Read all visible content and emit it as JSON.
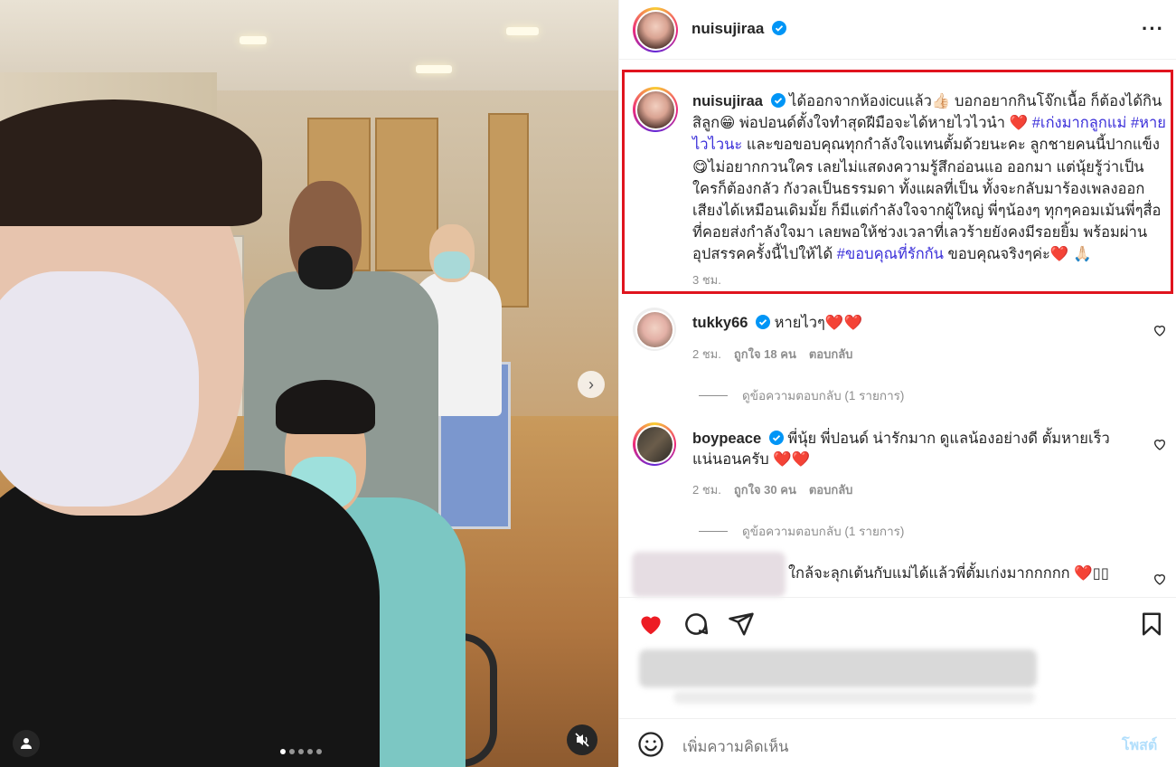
{
  "post": {
    "username": "nuisujiraa",
    "caption_parts": {
      "p1": "ได้ออกจากห้องicuแล้ว👍🏻 บอกอยากกินโจ๊กเนื้อ ก็ต้องได้กินสิลูก😁 พ่อปอนด์ตั้งใจทำสุดฝีมือจะได้หายไวไวน๋า ",
      "heart1": "❤️",
      "tag1": "#เก่งมากลูกแม่",
      "tag2": "#หายไวไวนะ",
      "p2": " และขอขอบคุณทุกกำลังใจแทนตั้มด้วยนะคะ ลูกชายคนนี้ปากแข็ง😋ไม่อยากกวนใคร เลยไม่แสดงความรู้สึกอ่อนแอ ออกมา แต่นุ้ยรู้ว่าเป็นใครก็ต้องกลัว กังวลเป็นธรรมดา ทั้งแผลที่เป็น ทั้งจะกลับมาร้องเพลงออกเสียงได้เหมือนเดิมมั้ย ก็มีแต่กำลังใจจากผู้ใหญ่ พี่ๆน้องๆ ทุกๆคอมเม้นพี่ๆสื่อที่คอยส่งกำลังใจมา เลยพอให้ช่วงเวลาที่เลวร้ายยังคงมีรอยยิ้ม พร้อมผ่านอุปสรรคครั้งนี้ไปให้ได้ ",
      "tag3": "#ขอบคุณที่รักกัน",
      "p3": " ขอบคุณจริงๆค่ะ",
      "heart2": "❤️",
      "pray": " 🙏🏻"
    },
    "time": "3 ชม."
  },
  "comments": [
    {
      "username": "tukky66",
      "text": " หายไวๆ",
      "hearts": "❤️❤️",
      "time": "2 ชม.",
      "likes": "ถูกใจ 18 คน",
      "reply": "ตอบกลับ",
      "view_replies": "ดูข้อความตอบกลับ (1 รายการ)"
    },
    {
      "username": "boypeace",
      "text": " พี่นุ้ย พี่ปอนด์ น่ารักมาก ดูแลน้องอย่างดี ตั้มหายเร็วแน่นอนครับ ",
      "hearts": "❤️❤️",
      "time": "2 ชม.",
      "likes": "ถูกใจ 30 คน",
      "reply": "ตอบกลับ",
      "view_replies": "ดูข้อความตอบกลับ (1 รายการ)"
    },
    {
      "text": "ใกล้จะลุกเต้นกับแม่ได้แล้วพี่ตั้มเก่งมากกกกก ❤️▯▯"
    }
  ],
  "input": {
    "placeholder": "เพิ่มความคิดเห็น",
    "post_label": "โพสต์"
  },
  "icons": {
    "more": "more-options-icon",
    "like": "heart-filled-icon",
    "comment": "comment-icon",
    "share": "share-icon",
    "save": "bookmark-icon",
    "emoji": "emoji-icon",
    "next": "chevron-right-icon",
    "mute": "muted-speaker-icon",
    "tag": "user-tag-icon"
  },
  "colors": {
    "like": "#ed1c24",
    "hashtag": "#3b2fd9",
    "highlight_box": "#e0141e",
    "verified": "#0095f6"
  },
  "carousel": {
    "slides": 5,
    "active": 1
  }
}
